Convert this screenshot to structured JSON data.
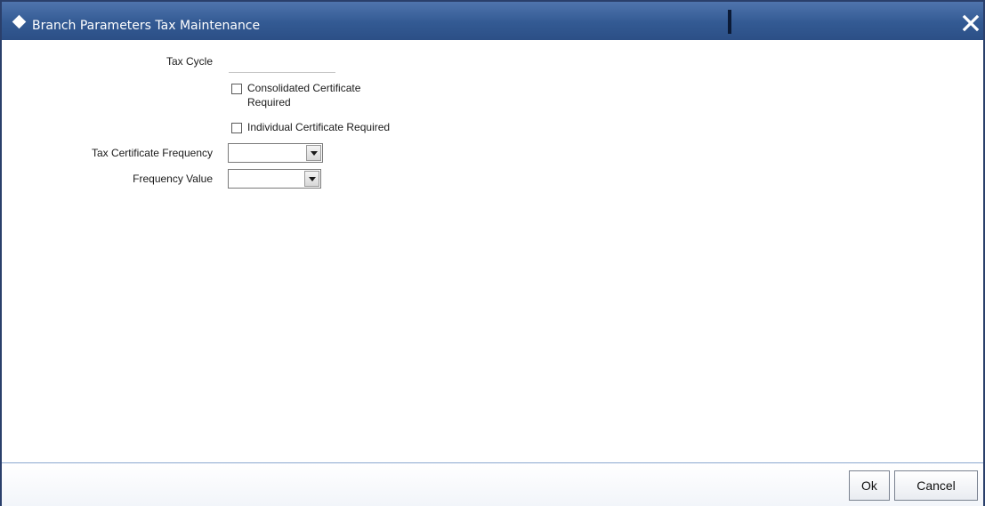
{
  "window": {
    "title": "Branch Parameters Tax Maintenance",
    "close_icon": "close-icon"
  },
  "form": {
    "tax_cycle": {
      "label": "Tax Cycle",
      "value": ""
    },
    "consolidated_certificate": {
      "label": "Consolidated Certificate Required",
      "checked": false
    },
    "individual_certificate": {
      "label": "Individual Certificate Required",
      "checked": false
    },
    "tax_certificate_frequency": {
      "label": "Tax Certificate Frequency",
      "value": ""
    },
    "frequency_value": {
      "label": "Frequency Value",
      "value": ""
    }
  },
  "footer": {
    "ok_label": "Ok",
    "cancel_label": "Cancel"
  },
  "colors": {
    "titlebar": "#335a93",
    "border": "#2a3f6b",
    "footer_rule": "#8aa7cf"
  }
}
